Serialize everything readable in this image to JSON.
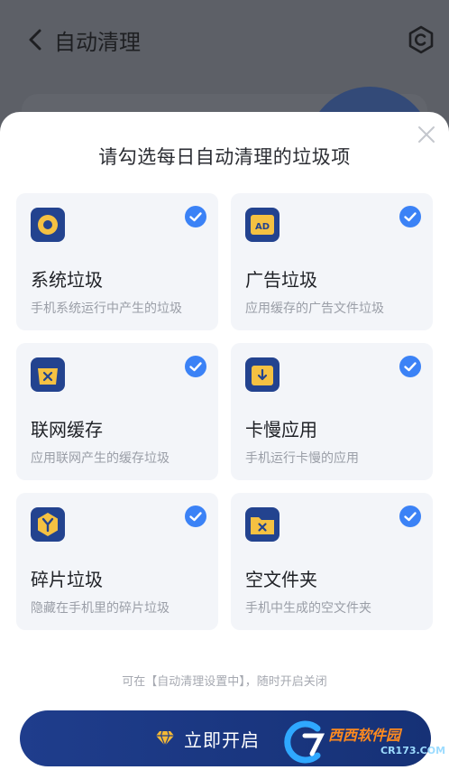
{
  "header": {
    "title": "自动清理"
  },
  "sheet": {
    "title": "请勾选每日自动清理的垃圾项",
    "items": [
      {
        "name": "系统垃圾",
        "desc": "手机系统运行中产生的垃圾",
        "icon": "system-junk-icon",
        "checked": true
      },
      {
        "name": "广告垃圾",
        "desc": "应用缓存的广告文件垃圾",
        "icon": "ad-icon",
        "icon_text": "AD",
        "checked": true
      },
      {
        "name": "联网缓存",
        "desc": "应用联网产生的缓存垃圾",
        "icon": "network-cache-icon",
        "checked": true
      },
      {
        "name": "卡慢应用",
        "desc": "手机运行卡慢的应用",
        "icon": "slow-app-icon",
        "checked": true
      },
      {
        "name": "碎片垃圾",
        "desc": "隐藏在手机里的碎片垃圾",
        "icon": "fragment-junk-icon",
        "checked": true
      },
      {
        "name": "空文件夹",
        "desc": "手机中生成的空文件夹",
        "icon": "empty-folder-icon",
        "checked": true
      }
    ],
    "hint": "可在【自动清理设置中】，随时开启关闭",
    "cta_label": "立即开启"
  },
  "watermark": {
    "text": "西西软件园",
    "sub": "CR173.COM"
  },
  "colors": {
    "accent": "#1f3d8c",
    "check": "#3b82f6",
    "icon_bg": "#23438f",
    "icon_accent": "#f5c142",
    "card_bg": "#f3f5f9"
  }
}
